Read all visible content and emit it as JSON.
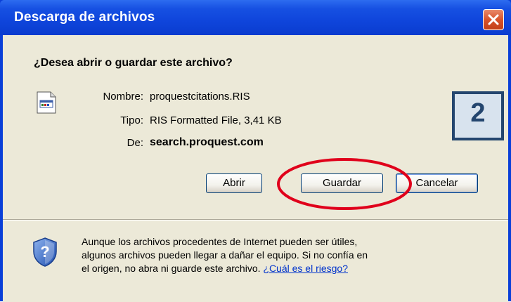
{
  "window": {
    "title": "Descarga de archivos"
  },
  "dialog": {
    "question": "¿Desea abrir o guardar este archivo?",
    "name_label": "Nombre:",
    "name_value": "proquestcitations.RIS",
    "type_label": "Tipo:",
    "type_value": "RIS Formatted File, 3,41 KB",
    "from_label": "De:",
    "from_value": "search.proquest.com",
    "step_badge": "2"
  },
  "buttons": {
    "open": "Abrir",
    "save": "Guardar",
    "cancel": "Cancelar"
  },
  "warning": {
    "line1": "Aunque los archivos procedentes de Internet pueden ser útiles,",
    "line2": "algunos archivos pueden llegar a dañar el equipo. Si no confía en",
    "line3": "el origen, no abra ni guarde este archivo.",
    "link": "¿Cuál es el riesgo?"
  },
  "colors": {
    "title_bar": "#0f45db",
    "dialog_bg": "#ece9d8",
    "highlight_ellipse": "#e0001b",
    "badge_border": "#24466f",
    "link": "#0033cc"
  }
}
